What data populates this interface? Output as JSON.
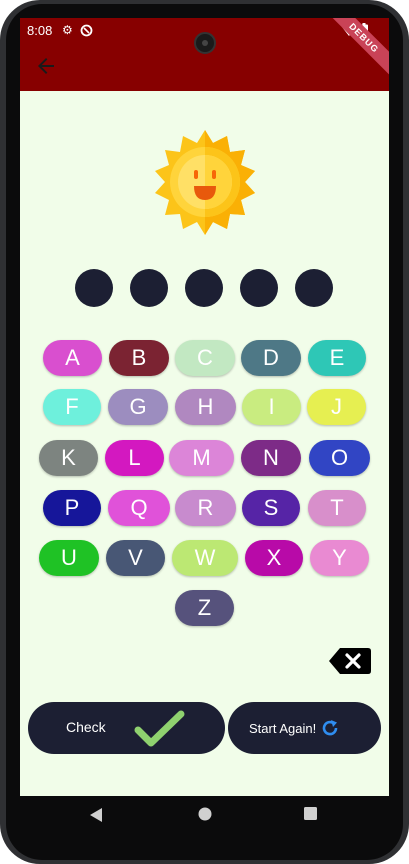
{
  "status": {
    "time": "8:08",
    "debug_label": "DEBUG"
  },
  "icons": {
    "settings": "settings-icon",
    "location": "location-icon",
    "wifi": "wifi-icon",
    "battery": "battery-icon",
    "back": "back-arrow-icon",
    "sun": "sun-face-icon",
    "backspace": "backspace-icon",
    "check": "checkmark-icon",
    "refresh": "refresh-icon"
  },
  "colors": {
    "appbar": "#870000",
    "background": "#f1fde9",
    "dot": "#1c1f33",
    "button": "#1c1f33"
  },
  "answer_slots": 5,
  "letters": [
    {
      "label": "A",
      "color": "#d94fcf"
    },
    {
      "label": "B",
      "color": "#7b2332"
    },
    {
      "label": "C",
      "color": "#c2e8c2"
    },
    {
      "label": "D",
      "color": "#4e7886"
    },
    {
      "label": "E",
      "color": "#2ec7b6"
    },
    {
      "label": "F",
      "color": "#6ef0dc"
    },
    {
      "label": "G",
      "color": "#9c8dbf"
    },
    {
      "label": "H",
      "color": "#b088c0"
    },
    {
      "label": "I",
      "color": "#c9ec80"
    },
    {
      "label": "J",
      "color": "#e6ef51"
    },
    {
      "label": "K",
      "color": "#7d8480"
    },
    {
      "label": "L",
      "color": "#d318c0"
    },
    {
      "label": "M",
      "color": "#dc85d8"
    },
    {
      "label": "N",
      "color": "#7d2b87"
    },
    {
      "label": "O",
      "color": "#3145c4"
    },
    {
      "label": "P",
      "color": "#16169a"
    },
    {
      "label": "Q",
      "color": "#e052d9"
    },
    {
      "label": "R",
      "color": "#c88bce"
    },
    {
      "label": "S",
      "color": "#5624a6"
    },
    {
      "label": "T",
      "color": "#d88fcb"
    },
    {
      "label": "U",
      "color": "#1fc225"
    },
    {
      "label": "V",
      "color": "#485775"
    },
    {
      "label": "W",
      "color": "#bce873"
    },
    {
      "label": "X",
      "color": "#b80aa8"
    },
    {
      "label": "Y",
      "color": "#e98ad2"
    },
    {
      "label": "Z",
      "color": "#56527c"
    }
  ],
  "buttons": {
    "check": "Check",
    "start_again": "Start Again!"
  }
}
